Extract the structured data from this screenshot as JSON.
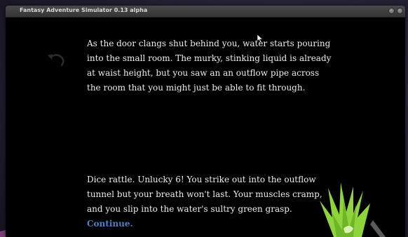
{
  "window": {
    "title": "Fantasy Adventure Simulator 0.13 alpha"
  },
  "story": {
    "paragraph_1": "As the door clangs shut behind you, water starts pouring into the small room. The murky, stinking liquid is already at waist height, but you saw an an outflow pipe across the room that you might just be able to fit through.",
    "paragraph_2": "Dice rattle. Unlucky 6! You strike out into the outflow tunnel but your breath won't last. Your muscles cramp, and you slip into the water's sultry green grasp. ",
    "continue_label": "Continue."
  },
  "icons": {
    "undo": "undo-arrow-icon",
    "decoration": "green-plant-icon",
    "cursor": "mouse-cursor-icon"
  },
  "colors": {
    "background": "#000000",
    "text": "#ececec",
    "link": "#4f7fc4",
    "plant": "#8fd43a"
  }
}
